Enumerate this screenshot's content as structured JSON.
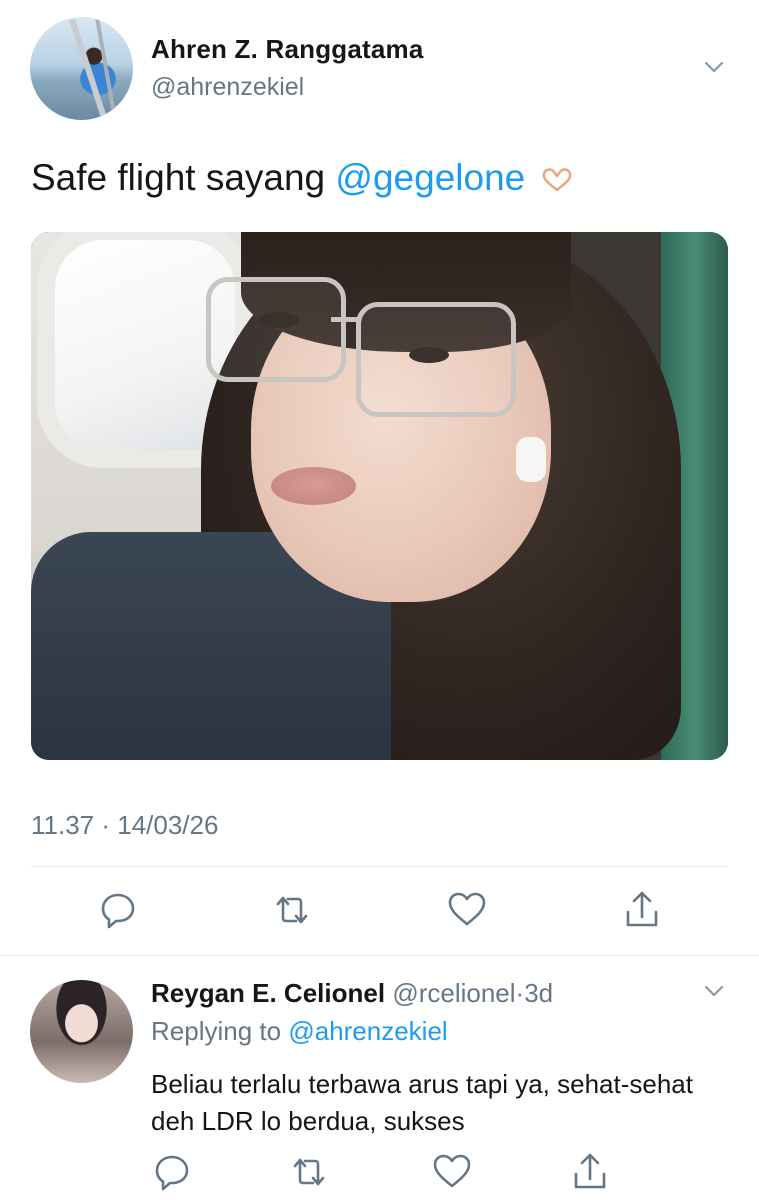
{
  "tweet": {
    "author": {
      "name": "Ahren Z. Ranggatama",
      "handle": "@ahrenzekiel"
    },
    "text_prefix": "Safe flight sayang ",
    "mention": "@gegelone",
    "emoji": "🫶",
    "timestamp": "11.37 · 14/03/26",
    "actions": [
      "reply-icon",
      "retweet-icon",
      "like-icon",
      "share-icon"
    ]
  },
  "reply": {
    "author": {
      "name": "Reygan E. Celionel",
      "handle": "@rcelionel",
      "separator": "·",
      "time": "3d"
    },
    "replying_to_label": "Replying to ",
    "replying_to_handle": "@ahrenzekiel",
    "text": "Beliau terlalu terbawa arus tapi ya, sehat-sehat deh LDR lo berdua, sukses"
  },
  "colors": {
    "link": "#1d9bf0",
    "secondary_text": "#657786",
    "divider": "#e6ecf0",
    "icon": "#657786"
  }
}
